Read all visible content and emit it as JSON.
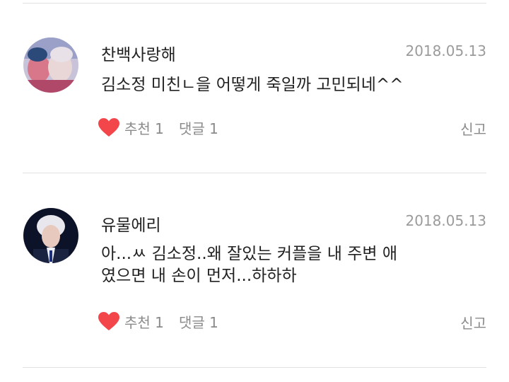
{
  "comments": [
    {
      "username": "찬백사랑해",
      "date": "2018.05.13",
      "body_lines": [
        "김소정 미친ㄴ을 어떻게 죽일까 고민되네^^"
      ],
      "like_label": "추천",
      "like_count": "1",
      "reply_label": "댓글",
      "reply_count": "1",
      "report_label": "신고",
      "avatar_icon": "avatar-photo"
    },
    {
      "username": "유물에리",
      "date": "2018.05.13",
      "body_lines": [
        "아...ㅆ 김소정..왜 잘있는 커플을 내 주변 애",
        "였으면 내 손이 먼저...하하하"
      ],
      "like_label": "추천",
      "like_count": "1",
      "reply_label": "댓글",
      "reply_count": "1",
      "report_label": "신고",
      "avatar_icon": "avatar-photo"
    }
  ],
  "colors": {
    "heart": "#f2464b",
    "divider": "#e2e2e2",
    "meta_text": "#9b9b9b"
  }
}
